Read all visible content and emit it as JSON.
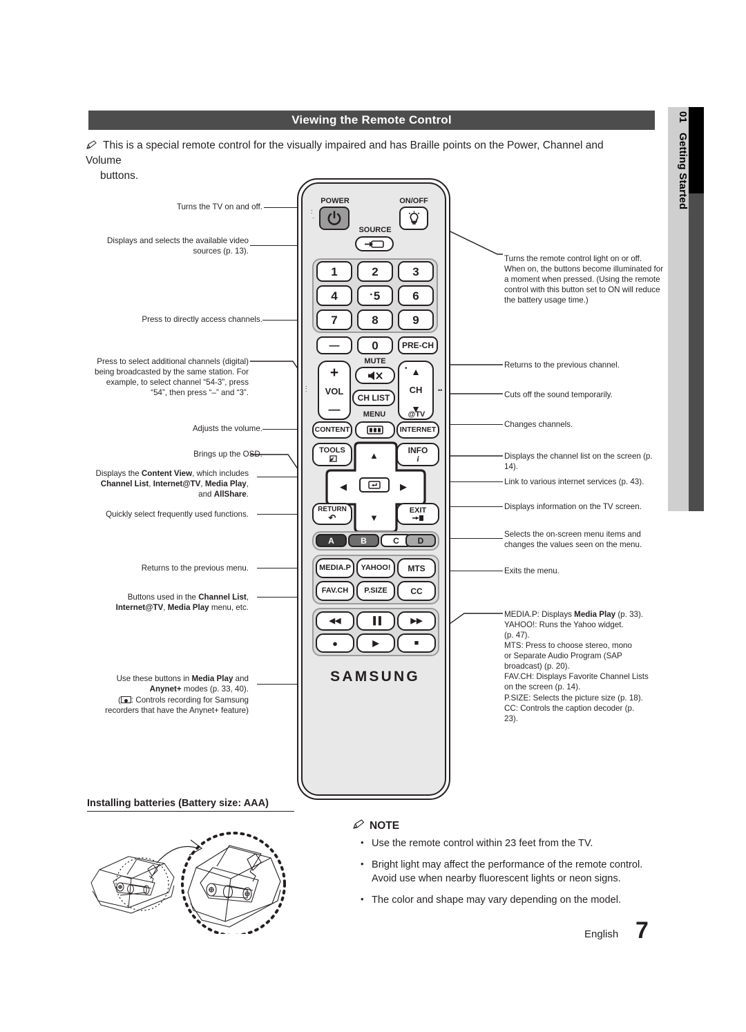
{
  "side_tab": {
    "number": "01",
    "label": "Getting Started"
  },
  "header": {
    "title": "Viewing the Remote Control"
  },
  "intro": {
    "icon": "pencil-note-icon",
    "line1": "This is a special remote control for the visually impaired and has Braille points on the Power, Channel and Volume",
    "line2": "buttons."
  },
  "callouts_left": [
    {
      "id": "power",
      "text": "Turns the TV on and off."
    },
    {
      "id": "source",
      "text": "Displays and selects the available video sources (p. 13)."
    },
    {
      "id": "numbers",
      "text": "Press to directly access channels."
    },
    {
      "id": "dash",
      "text": "Press to select additional channels (digital) being broadcasted by the same station. For example, to select channel “54-3”, press “54”, then press “–” and “3”."
    },
    {
      "id": "vol",
      "text": "Adjusts the volume."
    },
    {
      "id": "menu",
      "text": "Brings up the OSD."
    },
    {
      "id": "content",
      "pre": "Displays the ",
      "b1": "Content View",
      "mid1": ", which includes ",
      "b2": "Channel List",
      "mid2": ", ",
      "b3": "Internet@TV",
      "mid3": ", ",
      "b4": "Media Play",
      "mid4": ", and ",
      "b5": "AllShare",
      "post": "."
    },
    {
      "id": "tools",
      "text": "Quickly select frequently used functions."
    },
    {
      "id": "return",
      "text": "Returns to the previous menu."
    },
    {
      "id": "abcd",
      "pre": "Buttons used in the ",
      "b1": "Channel List",
      "mid1": ", ",
      "b2": "Internet@TV",
      "mid2": ", ",
      "b3": "Media Play",
      "post": " menu, etc."
    },
    {
      "id": "media",
      "pre": "Use these buttons in ",
      "b1": "Media Play",
      "mid1": " and ",
      "b2": "Anynet+",
      "post": " modes (p. 33, 40).",
      "line3a": "(",
      "line3b": ": Controls recording for Samsung",
      "line4": "recorders that have the Anynet+ feature)"
    }
  ],
  "callouts_right": [
    {
      "id": "onoff",
      "text": "Turns the remote control light on or off. When on, the buttons become illuminated for a moment when pressed. (Using the remote control with this button set to ON will reduce the battery usage time.)"
    },
    {
      "id": "prech",
      "text": "Returns to the previous channel."
    },
    {
      "id": "mute",
      "text": "Cuts off the sound temporarily."
    },
    {
      "id": "ch",
      "text": "Changes channels."
    },
    {
      "id": "chlist",
      "text": "Displays the channel list on the screen (p. 14)."
    },
    {
      "id": "internet",
      "text": "Link to various internet services (p. 43)."
    },
    {
      "id": "info",
      "text": "Displays information on the TV screen."
    },
    {
      "id": "arrows",
      "text": "Selects the on-screen menu items and changes the values seen on the menu."
    },
    {
      "id": "exit",
      "text": "Exits the menu."
    }
  ],
  "callout_media_right": {
    "l1a": "MEDIA.P: Displays ",
    "l1b": "Media Play",
    "l1c": " (p. 33).",
    "l2": "YAHOO!: Runs the Yahoo widget.",
    "l3": "(p. 47).",
    "l4": "MTS: Press to choose stereo, mono",
    "l5": "or Separate Audio Program (SAP",
    "l6": "broadcast) (p. 20).",
    "l7": "FAV.CH: Displays Favorite Channel Lists",
    "l8": "on the screen (p. 14).",
    "l9": "P.SIZE: Selects the picture size (p. 18).",
    "l10": "CC: Controls the caption decoder (p.",
    "l11": "23)."
  },
  "remote": {
    "brand": "SAMSUNG",
    "labels": {
      "power": "POWER",
      "onoff": "ON/OFF",
      "source": "SOURCE",
      "mute": "MUTE",
      "menu": "MENU",
      "attv": "@TV"
    },
    "buttons": {
      "power_icon": "power-icon",
      "onoff_icon": "bulb-icon",
      "source_icon": "source-arrow-icon",
      "numbers": [
        "1",
        "2",
        "3",
        "4",
        "5",
        "6",
        "7",
        "8",
        "9"
      ],
      "dash": "—",
      "zero": "0",
      "prech": "PRE-CH",
      "mute_icon": "mute-speaker-icon",
      "vol": "VOL",
      "vol_plus": "+",
      "vol_minus": "—",
      "ch": "CH",
      "ch_up": "▲",
      "ch_down": "▼",
      "chlist": "CH LIST",
      "content": "CONTENT",
      "menu_icon": "menu-grid-icon",
      "internet": "INTERNET",
      "tools": "TOOLS",
      "info": "INFO",
      "enter_icon": "enter-icon",
      "return": "RETURN",
      "exit": "EXIT",
      "color_a": "A",
      "color_b": "B",
      "color_c": "C",
      "color_d": "D",
      "mediap": "MEDIA.P",
      "yahoo": "YAHOO!",
      "mts": "MTS",
      "favch": "FAV.CH",
      "psize": "P.SIZE",
      "cc": "CC",
      "rew": "◀◀",
      "pause": "▐▐",
      "ff": "▶▶",
      "rec": "●",
      "play": "▶",
      "stop": "■"
    }
  },
  "battery": {
    "title": "Installing batteries (Battery size: AAA)",
    "image": "battery-install-illustration"
  },
  "note": {
    "icon": "pencil-note-icon",
    "heading": "NOTE",
    "items": [
      "Use the remote control within 23 feet from the TV.",
      "Bright light may affect the performance of the remote control. Avoid use when nearby fluorescent lights or neon signs.",
      "The color and shape may vary depending on the model."
    ]
  },
  "footer": {
    "language": "English",
    "page": "7"
  },
  "colors": {
    "header_bg": "#4d4d4d",
    "tab_bg": "#cfcfcf",
    "bar_black": "#000000",
    "bar_gray": "#4d4d4d",
    "remote_body": "#e8e8e8",
    "ink": "#231f20"
  }
}
